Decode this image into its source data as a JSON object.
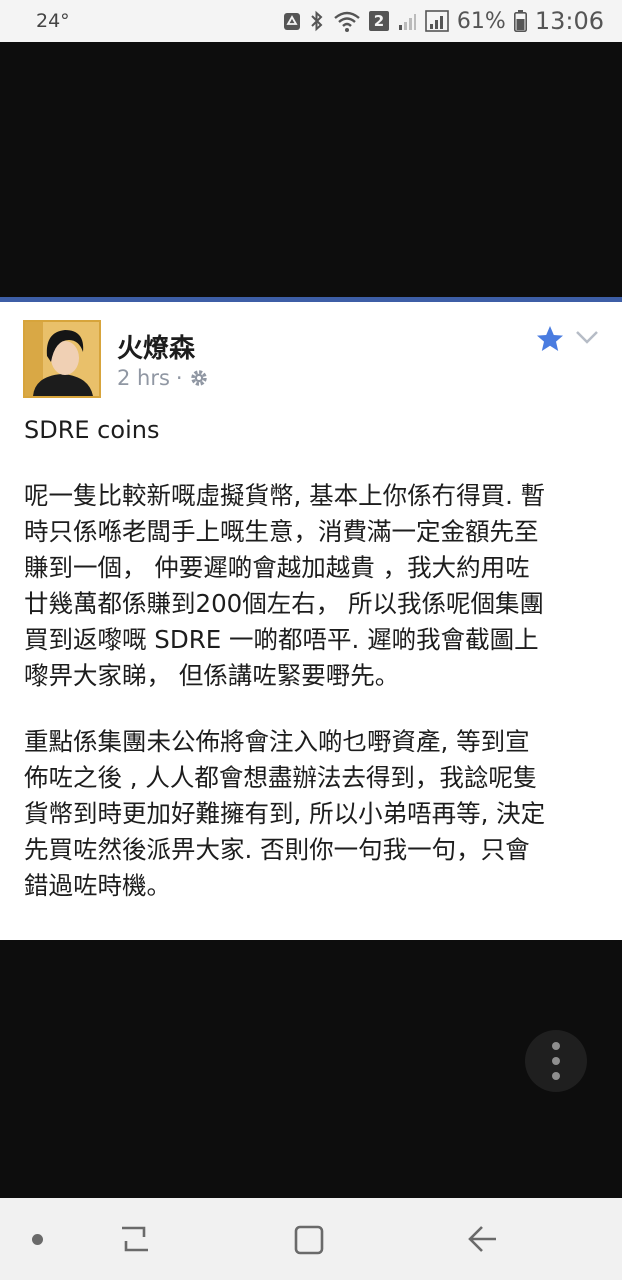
{
  "status_bar": {
    "temperature": "24°",
    "sim_badge": "2",
    "battery_percent": "61%",
    "time": "13:06"
  },
  "post": {
    "author": "火燎森",
    "time_ago": "2 hrs",
    "meta_separator": "·",
    "title": "SDRE coins",
    "paragraph_1_lines": [
      "呢一隻比較新嘅虛擬貨幣, 基本上你係冇得買. 暫",
      "時只係喺老闆手上嘅生意，消費滿一定金額先至",
      "賺到一個， 仲要遲啲會越加越貴 ，我大約用咗",
      "廿幾萬都係賺到200個左右， 所以我係呢個集團",
      "買到返嚟嘅 SDRE 一啲都唔平.  遲啲我會截圖上",
      "嚟畀大家睇， 但係講咗緊要嘢先。"
    ],
    "paragraph_2_lines": [
      "重點係集團未公佈將會注入啲乜嘢資產, 等到宣",
      "佈咗之後 , 人人都會想盡辦法去得到，我諗呢隻",
      "貨幣到時更加好難擁有到, 所以小弟唔再等, 決定",
      "先買咗然後派畀大家. 否則你一句我一句，只會",
      "錯過咗時機。"
    ],
    "colors": {
      "star": "#4a7ce0",
      "brand_rule": "#3d5ea6"
    }
  }
}
